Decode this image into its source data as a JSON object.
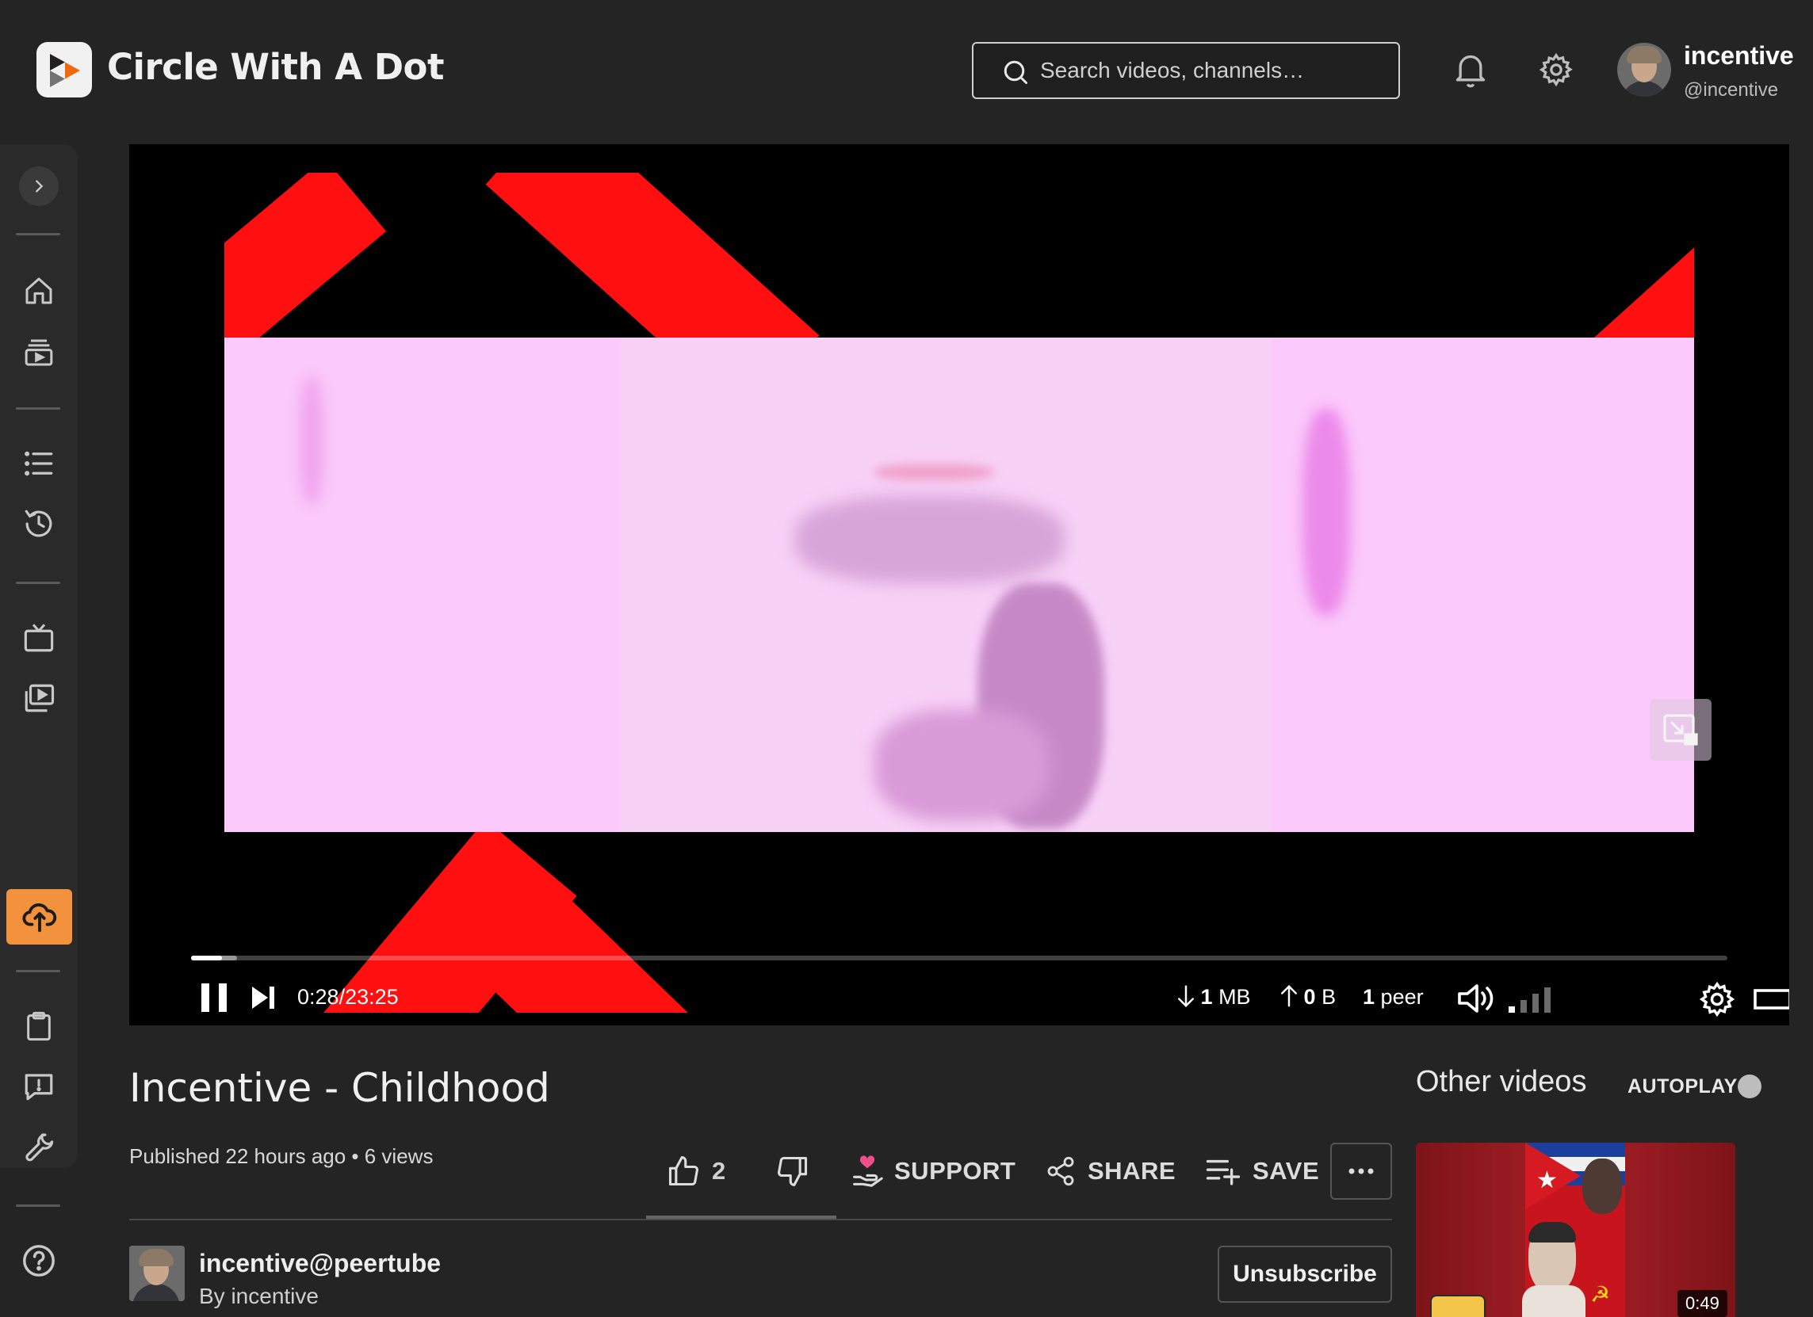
{
  "header": {
    "site_title": "Circle With A Dot",
    "search_placeholder": "Search videos, channels…",
    "user_name": "incentive",
    "user_handle": "@incentive"
  },
  "sidebar": {
    "items": [
      {
        "icon": "chevron-right-icon",
        "label": "Expand menu"
      },
      {
        "icon": "home-icon",
        "label": "Home"
      },
      {
        "icon": "subscriptions-icon",
        "label": "Subscriptions"
      },
      {
        "icon": "list-icon",
        "label": "Playlists"
      },
      {
        "icon": "history-icon",
        "label": "History"
      },
      {
        "icon": "tv-icon",
        "label": "Channels"
      },
      {
        "icon": "videos-icon",
        "label": "Videos"
      },
      {
        "icon": "upload-cloud-icon",
        "label": "Upload",
        "active": true
      },
      {
        "icon": "clipboard-icon",
        "label": "Reports"
      },
      {
        "icon": "feedback-icon",
        "label": "Feedback"
      },
      {
        "icon": "wrench-icon",
        "label": "Admin"
      },
      {
        "icon": "help-icon",
        "label": "Help"
      }
    ],
    "active_color": "#f3923d"
  },
  "player": {
    "current_time": "0:28",
    "separator": "/",
    "duration": "23:25",
    "progress_fraction": 0.02,
    "buffered_fraction": 0.03,
    "download_value": "1",
    "download_unit": "MB",
    "upload_value": "0",
    "upload_unit": "B",
    "peers_value": "1",
    "peers_label": "peer"
  },
  "video": {
    "title": "Incentive - Childhood",
    "meta": "Published 22 hours ago • 6 views",
    "likes": "2",
    "support_label": "SUPPORT",
    "share_label": "SHARE",
    "save_label": "SAVE"
  },
  "channel": {
    "name": "incentive@peertube",
    "by": "By incentive",
    "unsubscribe_label": "Unsubscribe"
  },
  "other_videos": {
    "title": "Other videos",
    "autoplay_label": "AUTOPLAY",
    "items": [
      {
        "duration": "0:49"
      }
    ]
  }
}
